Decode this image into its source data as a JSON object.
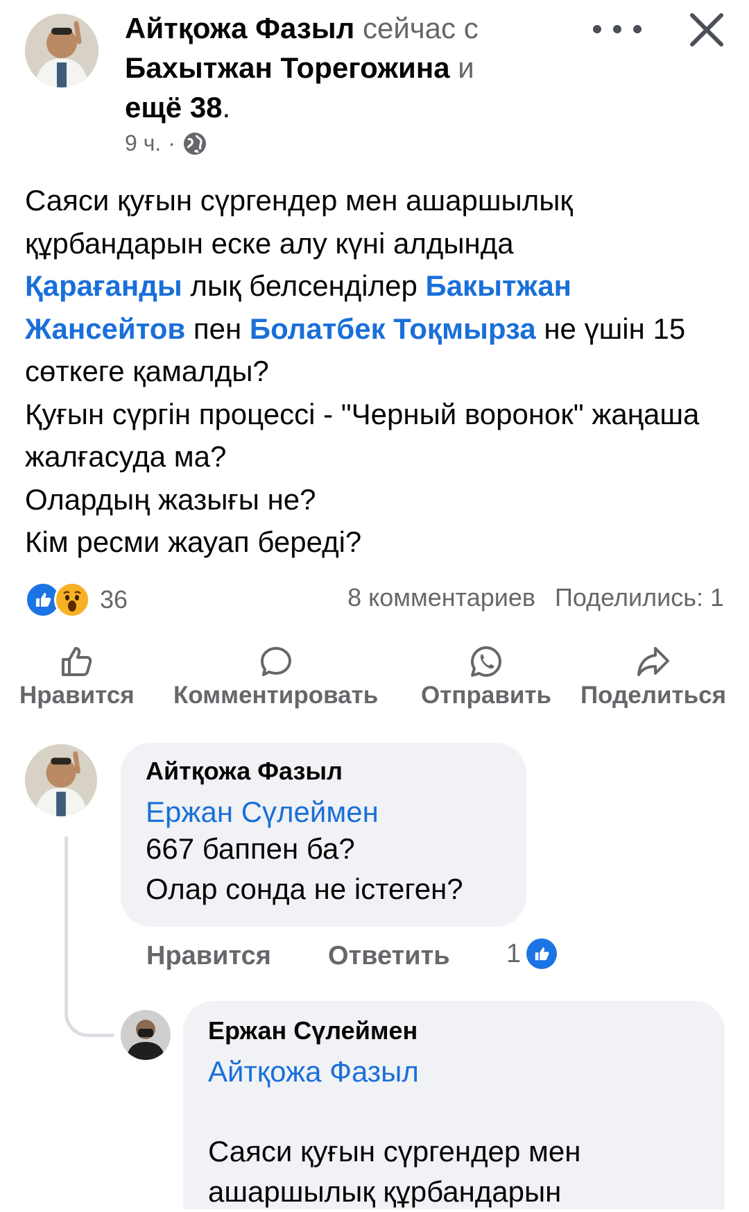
{
  "post": {
    "author": "Айтқожа Фазыл",
    "with_text": "сейчас с",
    "tagged_person": "Бахытжан Торегожина",
    "and_text": "и",
    "others": "ещё 38",
    "period": ".",
    "time": "9 ч.",
    "dot": "·",
    "body": {
      "line1": "Саяси қуғын сүргендер мен ашаршылық құрбандарын еске алу күні алдында",
      "mention_city": "Қарағанды",
      "after_city": " лық  белсенділер ",
      "mention1": "Бакытжан Жансейтов",
      "pen": " пен ",
      "mention2": "Болатбек Тоқмырза",
      "after_mention2": " не үшін 15 сөткеге қамалды?",
      "line3": "Қуғын сүргін процессі - \"Черный воронок\" жаңаша жалғасуда ма?",
      "line4": "Олардың жазығы не?",
      "line5": "Кім ресми жауап береді?"
    },
    "reaction_count": "36",
    "comments_count": "8 комментариев",
    "shares": "Поделились: 1"
  },
  "actions": {
    "like": "Нравится",
    "comment": "Комментировать",
    "send": "Отправить",
    "share": "Поделиться"
  },
  "comments": [
    {
      "author": "Айтқожа Фазыл",
      "mention": "Ержан Сүлеймен",
      "lines": [
        "667 баппен ба?",
        "Олар сонда не істеген?"
      ],
      "like_label": "Нравится",
      "reply_label": "Ответить",
      "like_count": "1"
    },
    {
      "author": "Ержан Сүлеймен",
      "mention": "Айтқожа Фазыл",
      "lines": [
        "Саяси қуғын сүргендер мен",
        "ашаршылық құрбандарын"
      ]
    }
  ],
  "colors": {
    "link": "#1a6fd9",
    "like_blue": "#1b74e4",
    "muted": "#65676b",
    "bubble": "#f0f2f5"
  },
  "icons": [
    "globe-icon",
    "more-dots-icon",
    "close-icon",
    "like-reaction-icon",
    "wow-reaction-icon",
    "thumbs-up-icon",
    "comment-icon",
    "whatsapp-icon",
    "share-icon"
  ]
}
